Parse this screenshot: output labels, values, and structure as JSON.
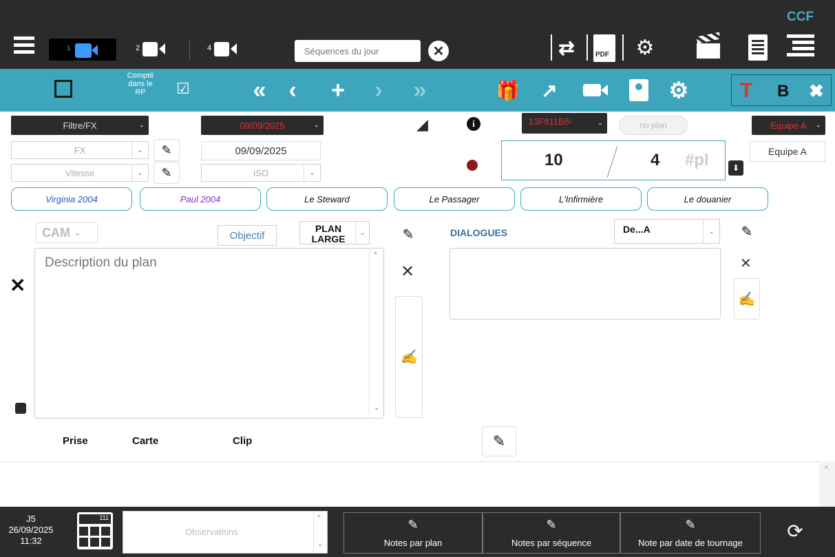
{
  "app": {
    "badge": "CCF"
  },
  "topbar": {
    "cam_views": [
      {
        "num": "1"
      },
      {
        "num": "2"
      },
      {
        "num": "4"
      }
    ],
    "search_placeholder": "Séquences du jour",
    "pdf_label": "PDF"
  },
  "toolbar": {
    "rp_label_line1": "Compté",
    "rp_label_line2": "dans le",
    "rp_label_line3": "RP",
    "checkmark": "☑",
    "style_t": "T",
    "style_b": "B"
  },
  "filters": {
    "filtre": "Filtre/FX",
    "date_select": "09/09/2025",
    "clip_id": "13F811B8-",
    "no_plan": "no plan",
    "equipe_select": "Equipe A",
    "fx": "FX",
    "vitesse": "Vitesse",
    "date_value": "09/09/2025",
    "iso": "ISO",
    "equipe_value": "Equipe A"
  },
  "counter": {
    "left": "10",
    "right": "4",
    "suffix": "#pl"
  },
  "characters": [
    "Virginia 2004",
    "Paul 2004",
    "Le Steward",
    "Le Passager",
    "L'Infirmière",
    "Le douanier"
  ],
  "character_colors": [
    "#2a56c6",
    "#8a2bd6",
    "#111111",
    "#111111",
    "#111111",
    "#111111"
  ],
  "plan": {
    "cam": "CAM",
    "objectif": "Objectif",
    "plan_line1": "PLAN",
    "plan_line2": "LARGE",
    "description_placeholder": "Description du plan",
    "dialogues_label": "DIALOGUES",
    "de_a": "De...A"
  },
  "take": {
    "prise": "Prise",
    "carte": "Carte",
    "clip": "Clip"
  },
  "bottom": {
    "day": "J5",
    "date": "26/09/2025",
    "time": "11:32",
    "calc_display": "111",
    "observations_placeholder": "Observations",
    "notes_plan": "Notes par plan",
    "notes_sequence": "Notes par séquence",
    "notes_date": "Note par date de tournage"
  },
  "colors": {
    "accent": "#3da6bc",
    "dark": "#2b2b2b",
    "red": "#e03030",
    "record": "#8b1a1a"
  }
}
